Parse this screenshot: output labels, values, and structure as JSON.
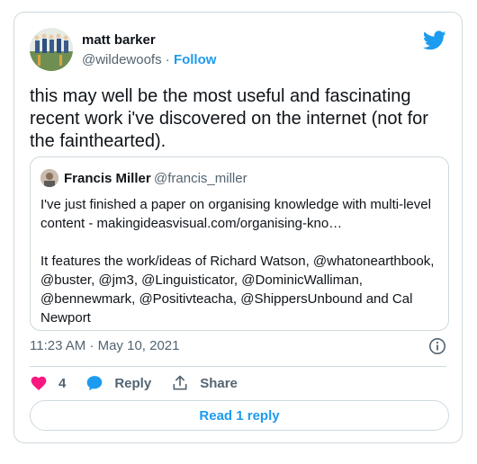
{
  "author": {
    "name": "matt barker",
    "handle": "@wildewoofs",
    "separator": " · ",
    "follow_label": "Follow"
  },
  "tweet": {
    "text": "this may well be the most useful and fascinating recent work i've discovered on the internet (not for the fainthearted)."
  },
  "quote": {
    "name": "Francis Miller",
    "handle": "@francis_miller",
    "text": "I've just finished a paper on organising knowledge with multi-level content - makingideasvisual.com/organising-kno…\n\nIt features the work/ideas of Richard Watson, @whatonearthbook, @buster, @jm3, @Linguisticator, @DominicWalliman, @bennewmark, @Positivteacha, @ShippersUnbound and Cal Newport"
  },
  "meta": {
    "timestamp": "11:23 AM · May 10, 2021"
  },
  "actions": {
    "like_count": "4",
    "reply_label": "Reply",
    "share_label": "Share"
  },
  "read_replies_label": "Read 1 reply",
  "colors": {
    "accent": "#1d9bf0",
    "like": "#f91880",
    "muted": "#536471",
    "border": "#cfd9de"
  },
  "icons": [
    "twitter-bird-icon",
    "info-icon",
    "heart-icon",
    "reply-bubble-icon",
    "share-icon"
  ]
}
